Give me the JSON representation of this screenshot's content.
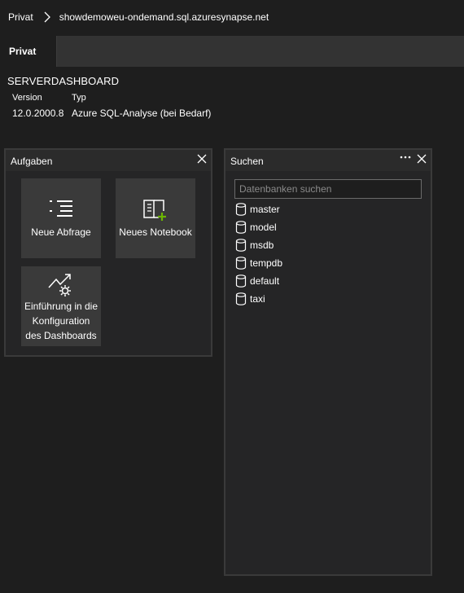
{
  "breadcrumb": {
    "root": "Privat",
    "server": "showdemoweu-ondemand.sql.azuresynapse.net"
  },
  "tabs": [
    {
      "label": "Privat",
      "active": true
    }
  ],
  "dashboard": {
    "title": "SERVERDASHBOARD",
    "properties": {
      "version_label": "Version",
      "version_value": "12.0.2000.8",
      "type_label": "Typ",
      "type_value": "Azure SQL-Analyse (bei Bedarf)"
    }
  },
  "tasks_widget": {
    "title": "Aufgaben",
    "items": [
      {
        "label": "Neue Abfrage",
        "icon": "new-query-icon"
      },
      {
        "label": "Neues Notebook",
        "icon": "new-notebook-icon"
      },
      {
        "label_lines": [
          "Einführung in die",
          "Konfiguration",
          "des Dashboards"
        ],
        "icon": "configure-dashboard-icon"
      }
    ]
  },
  "search_widget": {
    "title": "Suchen",
    "placeholder": "Datenbanken suchen",
    "value": "",
    "databases": [
      "master",
      "model",
      "msdb",
      "tempdb",
      "default",
      "taxi"
    ]
  },
  "colors": {
    "background": "#1e1e1e",
    "tabbar": "#333333",
    "widget": "#252526",
    "tile": "#3a3a3a",
    "accent_green": "#6bb700",
    "text": "#ffffff"
  }
}
